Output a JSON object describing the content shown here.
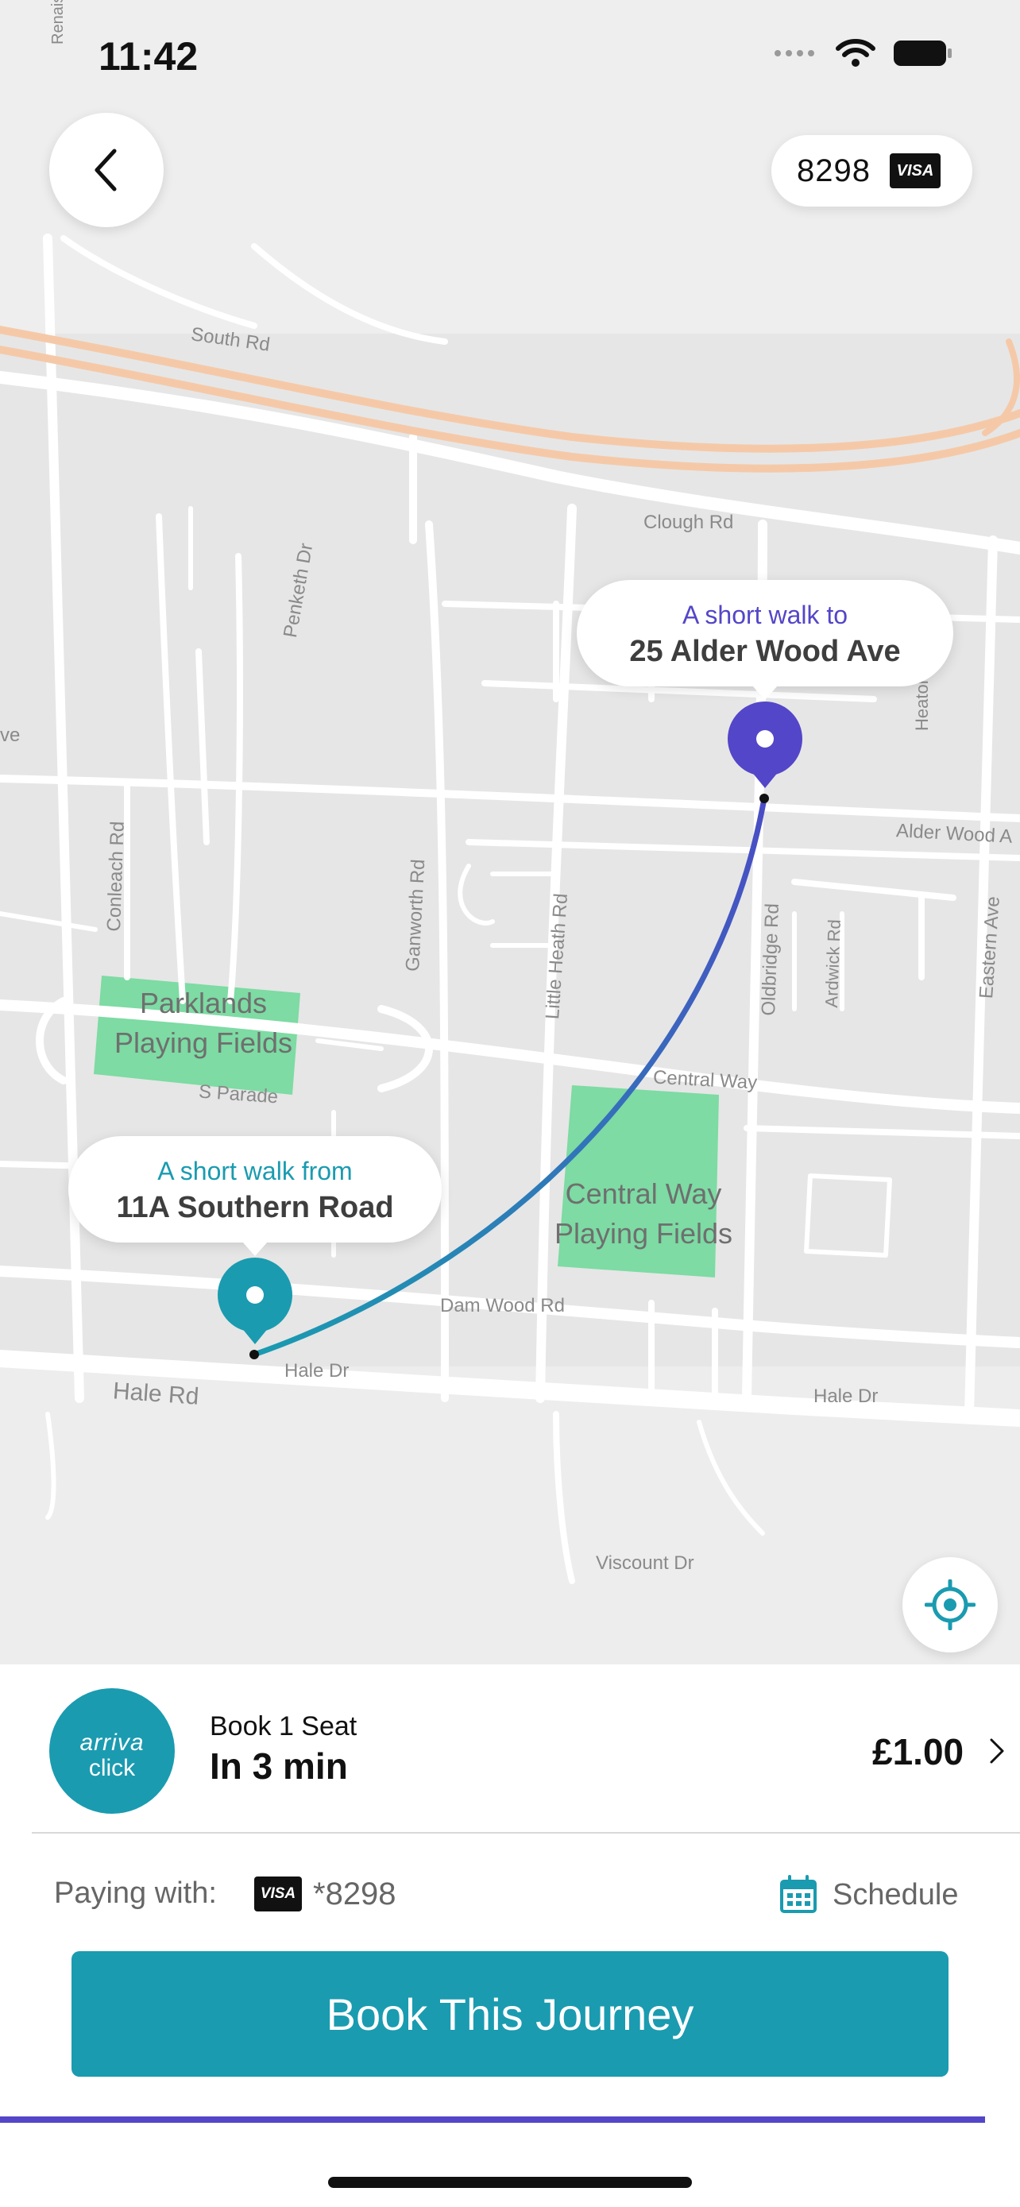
{
  "status_bar": {
    "time": "11:42"
  },
  "header": {
    "card_last4": "8298",
    "card_brand": "VISA"
  },
  "map": {
    "road_labels": {
      "renaissance": "Renaissance",
      "south_rd": "South Rd",
      "clough_rd": "Clough Rd",
      "penketh_dr": "Penketh Dr",
      "heaton": "Heaton",
      "ave_left": "ve",
      "alder_wood": "Alder Wood A",
      "conleach_rd": "Conleach Rd",
      "ganworth_rd": "Ganworth Rd",
      "little_heath_rd": "Little Heath Rd",
      "oldbridge_rd": "Oldbridge Rd",
      "ardwick_rd": "Ardwick Rd",
      "eastern_ave": "Eastern Ave",
      "s_parade": "S Parade",
      "central_way": "Central Way",
      "dam_wood_rd": "Dam Wood Rd",
      "hale_dr_1": "Hale Dr",
      "hale_dr_2": "Hale Dr",
      "hale_rd": "Hale Rd",
      "viscount_dr": "Viscount Dr"
    },
    "parks": {
      "parklands": "Parklands Playing Fields",
      "central_way": "Central Way Playing Fields"
    },
    "destination": {
      "caption": "A short walk to",
      "address": "25 Alder Wood Ave",
      "color": "#5346c8"
    },
    "origin": {
      "caption": "A short walk from",
      "address": "11A Southern Road",
      "color": "#1a9bb0"
    }
  },
  "booking": {
    "brand_line1": "arriva",
    "brand_line2": "click",
    "seats_label": "Book 1 Seat",
    "eta_label": "In 3 min",
    "price": "£1.00",
    "paying_label": "Paying with:",
    "paying_card_brand": "VISA",
    "paying_card": "*8298",
    "schedule_label": "Schedule",
    "cta_label": "Book This Journey"
  },
  "colors": {
    "accent_teal": "#1a9bb0",
    "accent_purple": "#5346c8",
    "park_green": "#7ddba3"
  }
}
